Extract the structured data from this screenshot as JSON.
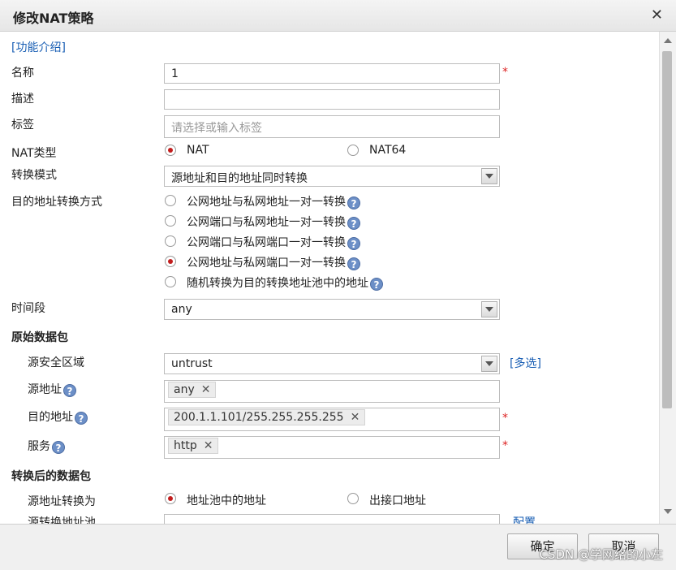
{
  "dialog": {
    "title": "修改NAT策略",
    "close": "✕"
  },
  "help_link": "[功能介绍]",
  "fields": {
    "name": {
      "label": "名称",
      "value": "1",
      "required": "*"
    },
    "desc": {
      "label": "描述",
      "value": ""
    },
    "tag": {
      "label": "标签",
      "placeholder": "请选择或输入标签"
    },
    "nat_type": {
      "label": "NAT类型",
      "options": [
        "NAT",
        "NAT64"
      ],
      "selected": "NAT"
    },
    "mode": {
      "label": "转换模式",
      "value": "源地址和目的地址同时转换"
    },
    "dst_method": {
      "label": "目的地址转换方式",
      "options": [
        "公网地址与私网地址一对一转换",
        "公网端口与私网地址一对一转换",
        "公网端口与私网端口一对一转换",
        "公网地址与私网端口一对一转换",
        "随机转换为目的转换地址池中的地址"
      ],
      "selected": "公网地址与私网端口一对一转换"
    },
    "schedule": {
      "label": "时间段",
      "value": "any"
    }
  },
  "original_packet": {
    "title": "原始数据包",
    "src_zone": {
      "label": "源安全区域",
      "value": "untrust",
      "multi": "[多选]"
    },
    "src_addr": {
      "label": "源地址",
      "tag": "any"
    },
    "dst_addr": {
      "label": "目的地址",
      "tag": "200.1.1.101/255.255.255.255",
      "required": "*"
    },
    "service": {
      "label": "服务",
      "tag": "http",
      "required": "*"
    }
  },
  "translated_packet": {
    "title": "转换后的数据包",
    "src_translate": {
      "label": "源地址转换为",
      "options": [
        "地址池中的地址",
        "出接口地址"
      ],
      "selected": "地址池中的地址"
    },
    "partial_label": "源转换地址池",
    "partial_link": "配置"
  },
  "buttons": {
    "ok": "确定",
    "cancel": "取消"
  },
  "watermark": "CSDN @学网络的小左",
  "icons": {
    "help": "?",
    "tag_remove": "✕"
  }
}
